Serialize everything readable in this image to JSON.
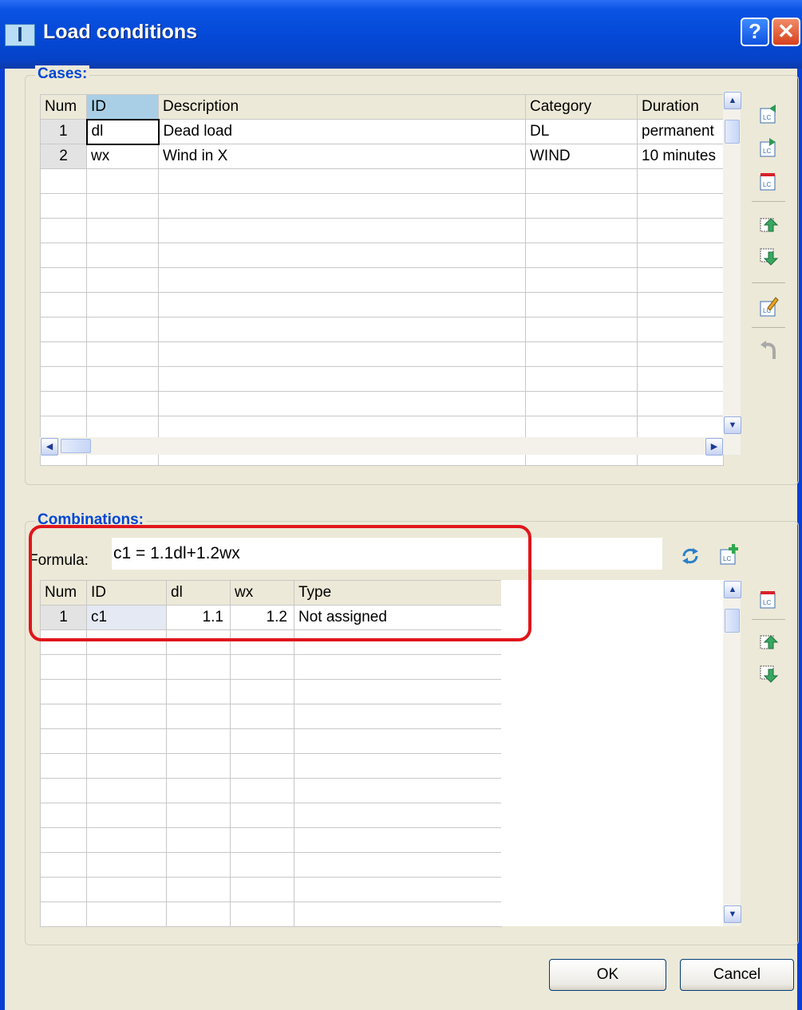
{
  "window": {
    "title": "Load conditions",
    "help_glyph": "?",
    "close_glyph": "✕",
    "app_icon_glyph": "I"
  },
  "cases": {
    "label": "Cases:",
    "columns": [
      "Num",
      "ID",
      "Description",
      "Category",
      "Duration"
    ],
    "rows": [
      {
        "num": "1",
        "id": "dl",
        "description": "Dead load",
        "category": "DL",
        "duration": "permanent"
      },
      {
        "num": "2",
        "id": "wx",
        "description": "Wind in X",
        "category": "WIND",
        "duration": "10 minutes"
      }
    ]
  },
  "combinations": {
    "label": "Combinations:",
    "formula_label": "Formula:",
    "formula_value": "c1 = 1.1dl+1.2wx",
    "columns": [
      "Num",
      "ID",
      "dl",
      "wx",
      "Type"
    ],
    "rows": [
      {
        "num": "1",
        "id": "c1",
        "dl": "1.1",
        "wx": "1.2",
        "type": "Not assigned"
      }
    ]
  },
  "buttons": {
    "ok": "OK",
    "cancel": "Cancel"
  },
  "icons": {
    "cases_toolbar": [
      "import-lc-icon",
      "export-lc-icon",
      "delete-lc-icon",
      "move-up-icon",
      "move-down-icon",
      "edit-lc-icon",
      "undo-icon"
    ],
    "combinations_toolbar": [
      "refresh-icon",
      "add-combination-icon",
      "delete-combination-icon",
      "move-up-icon",
      "move-down-icon"
    ]
  },
  "colors": {
    "title_bar": "#0a54e3",
    "group_label": "#0046d5",
    "highlight": "#e0161b",
    "dialog_bg": "#ece9d8"
  }
}
